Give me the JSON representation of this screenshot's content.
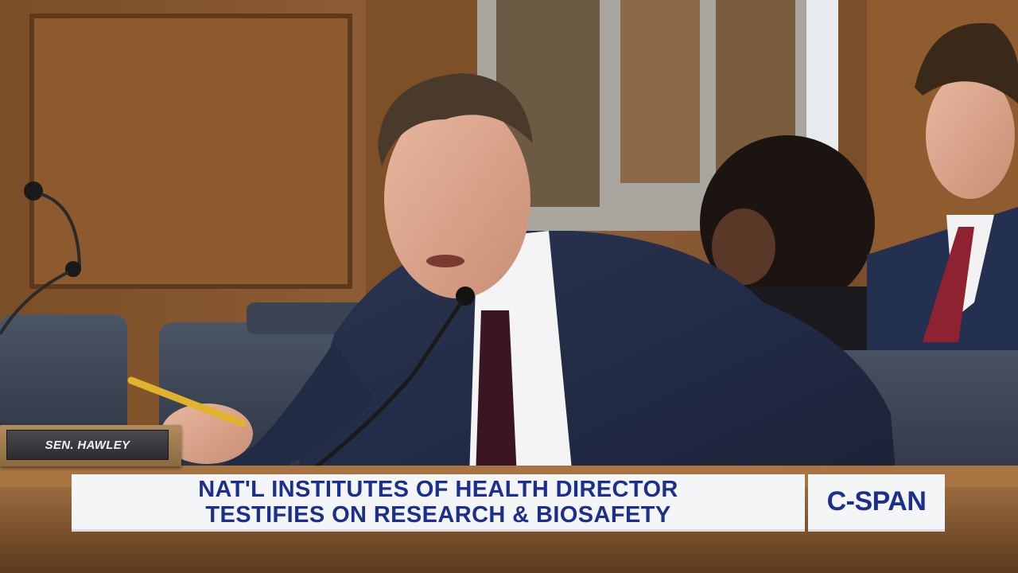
{
  "nameplate": {
    "text": "SEN. HAWLEY"
  },
  "chyron": {
    "line1": "NAT'L INSTITUTES OF HEALTH DIRECTOR",
    "line2": "TESTIFIES ON RESEARCH & BIOSAFETY"
  },
  "logo": {
    "text": "C-SPAN"
  },
  "colors": {
    "chyron_text": "#1d2f8c",
    "chyron_bg": "#f4f5f7",
    "wood_wall": "#8a5a2e",
    "chair_blue": "#3c4656"
  }
}
